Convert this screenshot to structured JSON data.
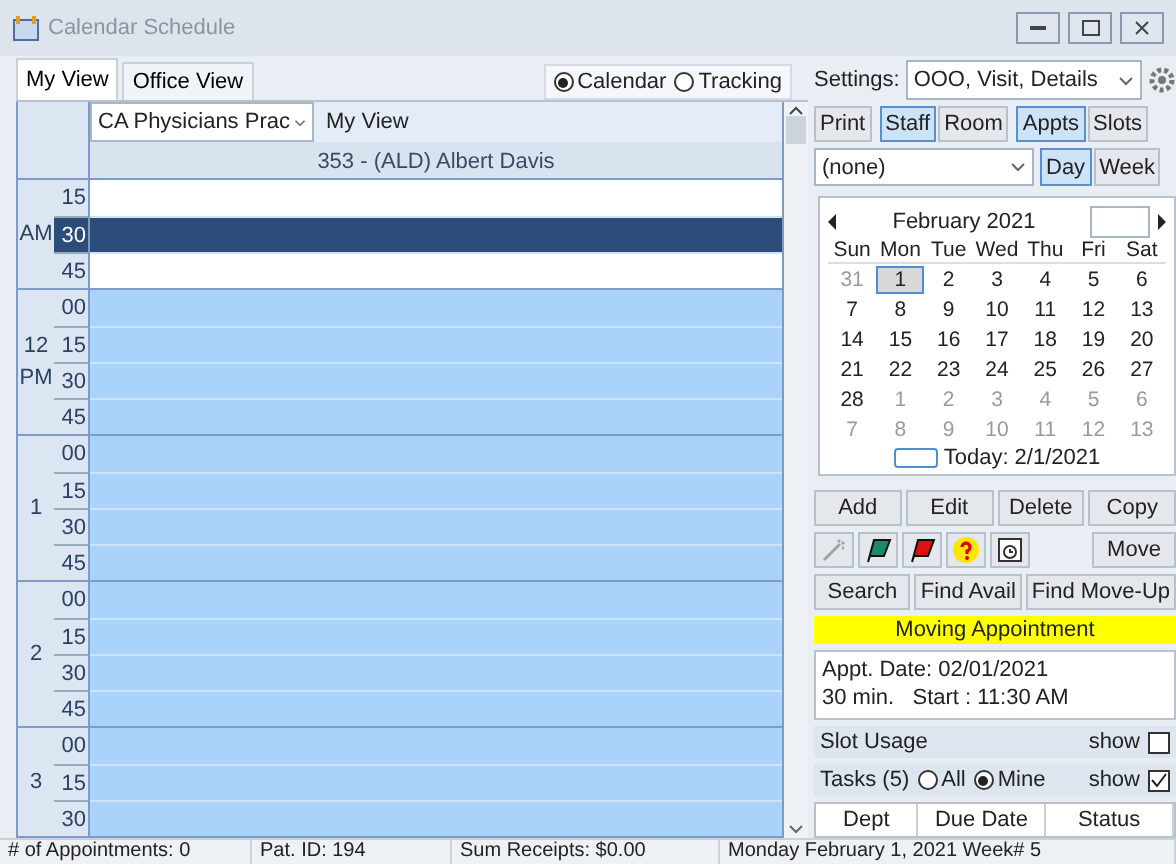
{
  "window": {
    "title": "Calendar Schedule"
  },
  "tabs": [
    {
      "label": "My View",
      "selected": true
    },
    {
      "label": "Office View",
      "selected": false
    }
  ],
  "view_mode": [
    {
      "label": "Calendar",
      "selected": true
    },
    {
      "label": "Tracking",
      "selected": false
    }
  ],
  "schedule": {
    "practice": "CA Physicians Prac",
    "view": "My View",
    "provider": "353  - (ALD) Albert Davis",
    "hours": [
      {
        "labels": [
          "AM"
        ],
        "slots": [
          {
            "minute": "15",
            "kind": "free"
          },
          {
            "minute": "30",
            "kind": "selected"
          },
          {
            "minute": "45",
            "kind": "free"
          }
        ]
      },
      {
        "labels": [
          "12",
          "PM"
        ],
        "slots": [
          {
            "minute": "00",
            "kind": "open"
          },
          {
            "minute": "15",
            "kind": "open"
          },
          {
            "minute": "30",
            "kind": "open"
          },
          {
            "minute": "45",
            "kind": "open"
          }
        ]
      },
      {
        "labels": [
          "1"
        ],
        "slots": [
          {
            "minute": "00",
            "kind": "open"
          },
          {
            "minute": "15",
            "kind": "open"
          },
          {
            "minute": "30",
            "kind": "open"
          },
          {
            "minute": "45",
            "kind": "open"
          }
        ]
      },
      {
        "labels": [
          "2"
        ],
        "slots": [
          {
            "minute": "00",
            "kind": "open"
          },
          {
            "minute": "15",
            "kind": "open"
          },
          {
            "minute": "30",
            "kind": "open"
          },
          {
            "minute": "45",
            "kind": "open"
          }
        ]
      },
      {
        "labels": [
          "3"
        ],
        "slots": [
          {
            "minute": "00",
            "kind": "open"
          },
          {
            "minute": "15",
            "kind": "open"
          },
          {
            "minute": "30",
            "kind": "open"
          }
        ]
      }
    ]
  },
  "settings": {
    "label": "Settings:",
    "value": "OOO, Visit, Details"
  },
  "print": "Print",
  "resource_toggle": [
    {
      "label": "Staff",
      "selected": true
    },
    {
      "label": "Room",
      "selected": false
    }
  ],
  "type_toggle": [
    {
      "label": "Appts",
      "selected": true
    },
    {
      "label": "Slots",
      "selected": false
    }
  ],
  "filter": {
    "value": "(none)"
  },
  "range_toggle": [
    {
      "label": "Day",
      "selected": true
    },
    {
      "label": "Week",
      "selected": false
    }
  ],
  "calendar": {
    "month": "February 2021",
    "weekdays": [
      "Sun",
      "Mon",
      "Tue",
      "Wed",
      "Thu",
      "Fri",
      "Sat"
    ],
    "weeks": [
      [
        {
          "day": "31",
          "muted": true,
          "selected": false
        },
        {
          "day": "1",
          "muted": false,
          "selected": true
        },
        {
          "day": "2",
          "muted": false,
          "selected": false
        },
        {
          "day": "3",
          "muted": false,
          "selected": false
        },
        {
          "day": "4",
          "muted": false,
          "selected": false
        },
        {
          "day": "5",
          "muted": false,
          "selected": false
        },
        {
          "day": "6",
          "muted": false,
          "selected": false
        }
      ],
      [
        {
          "day": "7",
          "muted": false,
          "selected": false
        },
        {
          "day": "8",
          "muted": false,
          "selected": false
        },
        {
          "day": "9",
          "muted": false,
          "selected": false
        },
        {
          "day": "10",
          "muted": false,
          "selected": false
        },
        {
          "day": "11",
          "muted": false,
          "selected": false
        },
        {
          "day": "12",
          "muted": false,
          "selected": false
        },
        {
          "day": "13",
          "muted": false,
          "selected": false
        }
      ],
      [
        {
          "day": "14",
          "muted": false,
          "selected": false
        },
        {
          "day": "15",
          "muted": false,
          "selected": false
        },
        {
          "day": "16",
          "muted": false,
          "selected": false
        },
        {
          "day": "17",
          "muted": false,
          "selected": false
        },
        {
          "day": "18",
          "muted": false,
          "selected": false
        },
        {
          "day": "19",
          "muted": false,
          "selected": false
        },
        {
          "day": "20",
          "muted": false,
          "selected": false
        }
      ],
      [
        {
          "day": "21",
          "muted": false,
          "selected": false
        },
        {
          "day": "22",
          "muted": false,
          "selected": false
        },
        {
          "day": "23",
          "muted": false,
          "selected": false
        },
        {
          "day": "24",
          "muted": false,
          "selected": false
        },
        {
          "day": "25",
          "muted": false,
          "selected": false
        },
        {
          "day": "26",
          "muted": false,
          "selected": false
        },
        {
          "day": "27",
          "muted": false,
          "selected": false
        }
      ],
      [
        {
          "day": "28",
          "muted": false,
          "selected": false
        },
        {
          "day": "1",
          "muted": true,
          "selected": false
        },
        {
          "day": "2",
          "muted": true,
          "selected": false
        },
        {
          "day": "3",
          "muted": true,
          "selected": false
        },
        {
          "day": "4",
          "muted": true,
          "selected": false
        },
        {
          "day": "5",
          "muted": true,
          "selected": false
        },
        {
          "day": "6",
          "muted": true,
          "selected": false
        }
      ],
      [
        {
          "day": "7",
          "muted": true,
          "selected": false
        },
        {
          "day": "8",
          "muted": true,
          "selected": false
        },
        {
          "day": "9",
          "muted": true,
          "selected": false
        },
        {
          "day": "10",
          "muted": true,
          "selected": false
        },
        {
          "day": "11",
          "muted": true,
          "selected": false
        },
        {
          "day": "12",
          "muted": true,
          "selected": false
        },
        {
          "day": "13",
          "muted": true,
          "selected": false
        }
      ]
    ],
    "today": "Today: 2/1/2021"
  },
  "actions": [
    "Add",
    "Edit",
    "Delete",
    "Copy"
  ],
  "tools": [
    {
      "kind": "wand",
      "disabled": true
    },
    {
      "kind": "green-flag",
      "disabled": false
    },
    {
      "kind": "red-flag",
      "disabled": false
    },
    {
      "kind": "help",
      "disabled": false
    },
    {
      "kind": "alarm",
      "disabled": false
    }
  ],
  "move": "Move",
  "search_actions": [
    "Search",
    "Find Avail",
    "Find Move-Up"
  ],
  "banner": "Moving Appointment",
  "details": [
    "Appt. Date: 02/01/2021",
    "30 min.   Start : 11:30 AM"
  ],
  "slot_usage": {
    "label": "Slot Usage",
    "show_label": "show",
    "checked": false
  },
  "tasks": {
    "label": "Tasks (5)",
    "filters": [
      {
        "label": "All",
        "selected": false
      },
      {
        "label": "Mine",
        "selected": true
      }
    ],
    "show_label": "show",
    "checked": true,
    "columns": [
      "Dept",
      "Due Date",
      "Status"
    ]
  },
  "status_bar": [
    "# of Appointments: 0",
    "Pat. ID: 194",
    "Sum Receipts: $0.00",
    "Monday February 1, 2021 Week# 5"
  ]
}
